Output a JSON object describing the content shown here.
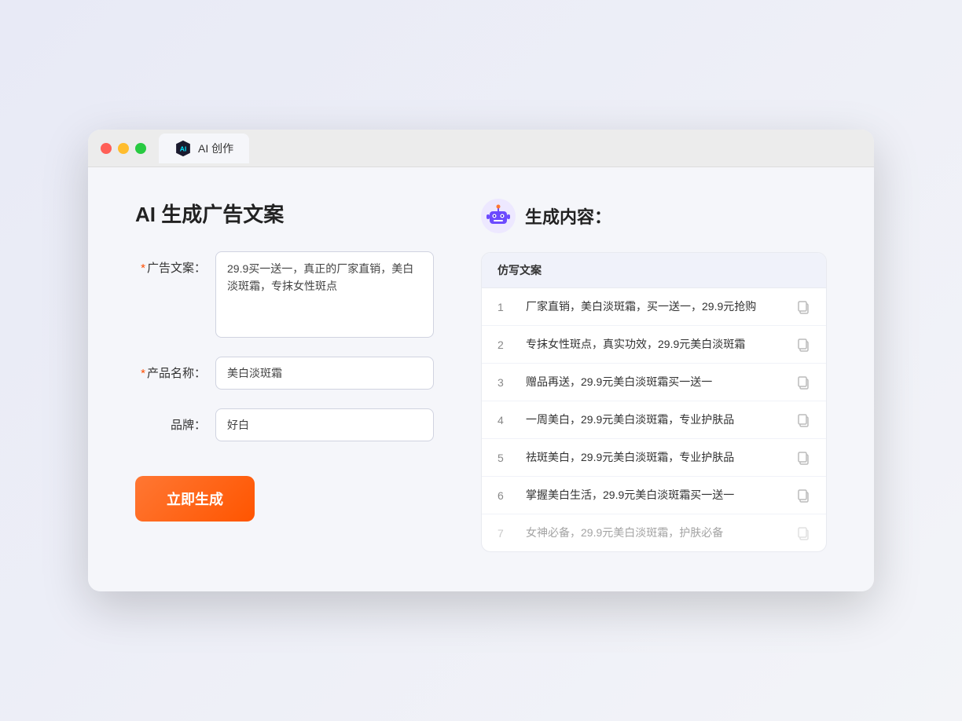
{
  "window": {
    "tab_label": "AI 创作"
  },
  "left_panel": {
    "title": "AI 生成广告文案",
    "ad_copy_label": "广告文案：",
    "ad_copy_required": "*",
    "ad_copy_value": "29.9买一送一，真正的厂家直销，美白淡斑霜，专抹女性斑点",
    "product_name_label": "产品名称：",
    "product_name_required": "*",
    "product_name_value": "美白淡斑霜",
    "brand_label": "品牌：",
    "brand_value": "好白",
    "generate_btn": "立即生成"
  },
  "right_panel": {
    "title": "生成内容：",
    "table_header": "仿写文案",
    "results": [
      {
        "num": "1",
        "text": "厂家直销，美白淡斑霜，买一送一，29.9元抢购",
        "faded": false
      },
      {
        "num": "2",
        "text": "专抹女性斑点，真实功效，29.9元美白淡斑霜",
        "faded": false
      },
      {
        "num": "3",
        "text": "赠品再送，29.9元美白淡斑霜买一送一",
        "faded": false
      },
      {
        "num": "4",
        "text": "一周美白，29.9元美白淡斑霜，专业护肤品",
        "faded": false
      },
      {
        "num": "5",
        "text": "祛斑美白，29.9元美白淡斑霜，专业护肤品",
        "faded": false
      },
      {
        "num": "6",
        "text": "掌握美白生活，29.9元美白淡斑霜买一送一",
        "faded": false
      },
      {
        "num": "7",
        "text": "女神必备，29.9元美白淡斑霜，护肤必备",
        "faded": true
      }
    ]
  },
  "colors": {
    "accent": "#ff6622",
    "required": "#ff4d00"
  }
}
